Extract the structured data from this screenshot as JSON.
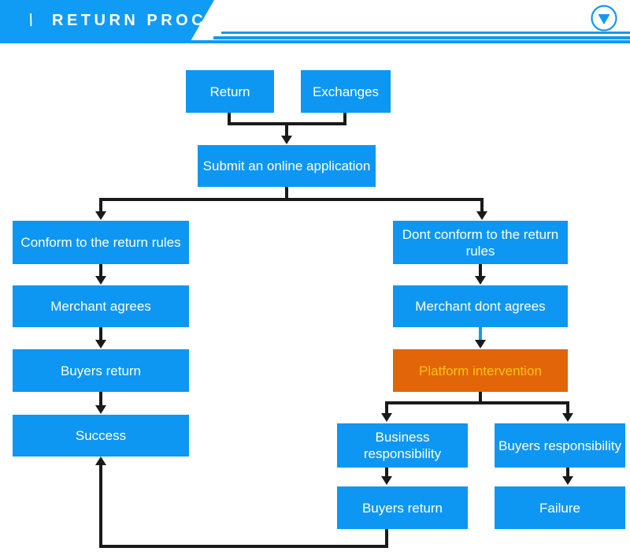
{
  "header": {
    "slash": "\\",
    "title": "RETURN PROCESS",
    "caret_icon": "chevron-down-circle-icon",
    "banner_color": "#109bf5",
    "rule_color": "#1598f2"
  },
  "theme": {
    "node_blue": "#0d97f2",
    "node_orange": "#e2650a",
    "node_text": "#ffffff",
    "accent_text": "#fcc40d",
    "connector": "#1a1a1a",
    "connector_blue": "#1398f2",
    "background": "#ffffff"
  },
  "flowchart": {
    "title": "RETURN PROCESS",
    "nodes": [
      {
        "id": "return",
        "label": "Return",
        "style": "blue"
      },
      {
        "id": "exchanges",
        "label": "Exchanges",
        "style": "blue"
      },
      {
        "id": "submit",
        "label": "Submit an online application",
        "style": "blue"
      },
      {
        "id": "conform",
        "label": "Conform to the return rules",
        "style": "blue"
      },
      {
        "id": "merchant-agrees",
        "label": "Merchant agrees",
        "style": "blue"
      },
      {
        "id": "buyers-return-left",
        "label": "Buyers return",
        "style": "blue"
      },
      {
        "id": "success",
        "label": "Success",
        "style": "blue"
      },
      {
        "id": "dont-conform",
        "label": "Dont conform to the return rules",
        "style": "blue"
      },
      {
        "id": "merchant-dont-agrees",
        "label": "Merchant dont agrees",
        "style": "blue"
      },
      {
        "id": "platform-intervention",
        "label": "Platform intervention",
        "style": "orange"
      },
      {
        "id": "business-responsibility",
        "label": "Business responsibility",
        "style": "blue"
      },
      {
        "id": "buyers-responsibility",
        "label": "Buyers responsibility",
        "style": "blue"
      },
      {
        "id": "buyers-return-right",
        "label": "Buyers return",
        "style": "blue"
      },
      {
        "id": "failure",
        "label": "Failure",
        "style": "blue"
      }
    ],
    "edges": [
      {
        "from": "return",
        "to": "submit"
      },
      {
        "from": "exchanges",
        "to": "submit"
      },
      {
        "from": "submit",
        "to": "conform"
      },
      {
        "from": "submit",
        "to": "dont-conform"
      },
      {
        "from": "conform",
        "to": "merchant-agrees"
      },
      {
        "from": "merchant-agrees",
        "to": "buyers-return-left"
      },
      {
        "from": "buyers-return-left",
        "to": "success"
      },
      {
        "from": "dont-conform",
        "to": "merchant-dont-agrees"
      },
      {
        "from": "merchant-dont-agrees",
        "to": "platform-intervention",
        "color": "blue"
      },
      {
        "from": "platform-intervention",
        "to": "business-responsibility"
      },
      {
        "from": "platform-intervention",
        "to": "buyers-responsibility"
      },
      {
        "from": "business-responsibility",
        "to": "buyers-return-right"
      },
      {
        "from": "buyers-responsibility",
        "to": "failure"
      },
      {
        "from": "buyers-return-right",
        "to": "success"
      }
    ]
  },
  "labels": {
    "return": "Return",
    "exchanges": "Exchanges",
    "submit": "Submit an online application",
    "conform": "Conform to the return rules",
    "merchant_agrees": "Merchant agrees",
    "buyers_return_left": "Buyers return",
    "success": "Success",
    "dont_conform": "Dont conform to the return rules",
    "merchant_dont_agrees": "Merchant dont agrees",
    "platform_intervention": "Platform intervention",
    "business_responsibility": "Business responsibility",
    "buyers_responsibility": "Buyers responsibility",
    "buyers_return_right": "Buyers return",
    "failure": "Failure"
  }
}
